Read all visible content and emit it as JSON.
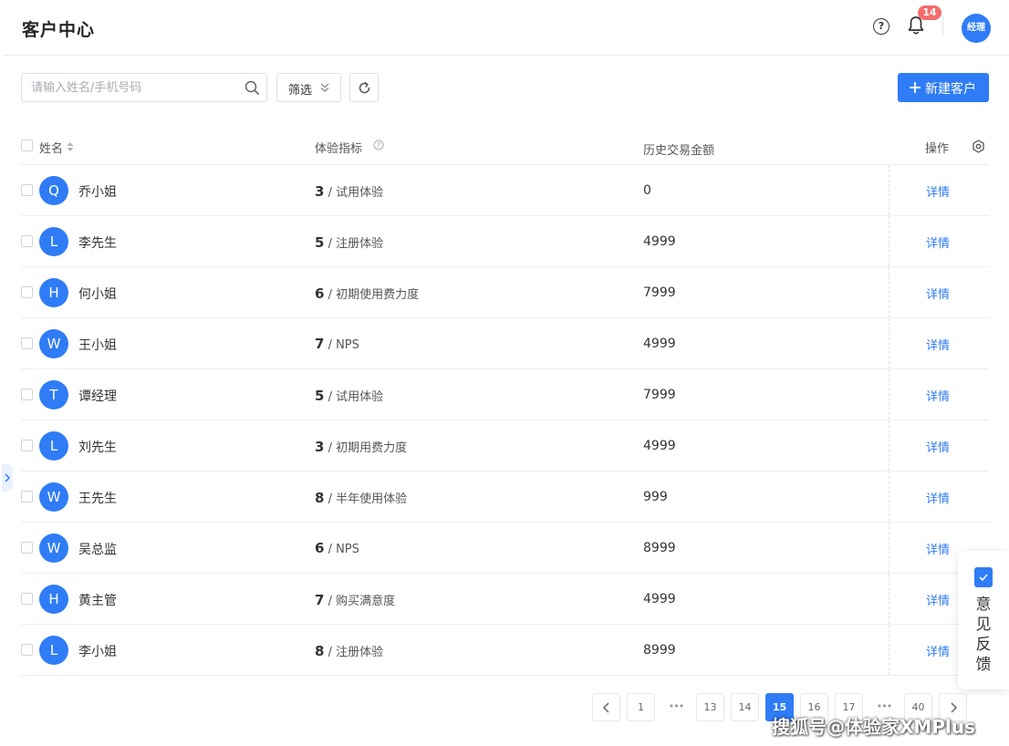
{
  "header": {
    "title": "客户中心",
    "notification_count": "14",
    "user_avatar": "经理"
  },
  "toolbar": {
    "search_placeholder": "请输入姓名/手机号码",
    "filter_label": "筛选",
    "new_label": "新建客户"
  },
  "table": {
    "columns": [
      "姓名",
      "体验指标",
      "历史交易金额",
      "操作"
    ],
    "rows": [
      {
        "initial": "Q",
        "name": "乔小姐",
        "score": "3",
        "metric": " / 试用体验",
        "amount": "0",
        "action": "详情"
      },
      {
        "initial": "L",
        "name": "李先生",
        "score": "5",
        "metric": " / 注册体验",
        "amount": "4999",
        "action": "详情"
      },
      {
        "initial": "H",
        "name": "何小姐",
        "score": "6",
        "metric": " / 初期使用费力度",
        "amount": "7999",
        "action": "详情"
      },
      {
        "initial": "W",
        "name": "王小姐",
        "score": "7",
        "metric": " / NPS",
        "amount": "4999",
        "action": "详情"
      },
      {
        "initial": "T",
        "name": "谭经理",
        "score": "5",
        "metric": " / 试用体验",
        "amount": "7999",
        "action": "详情"
      },
      {
        "initial": "L",
        "name": "刘先生",
        "score": "3",
        "metric": " / 初期用费力度",
        "amount": "4999",
        "action": "详情"
      },
      {
        "initial": "W",
        "name": "王先生",
        "score": "8",
        "metric": " / 半年使用体验",
        "amount": "999",
        "action": "详情"
      },
      {
        "initial": "W",
        "name": "吴总监",
        "score": "6",
        "metric": " / NPS",
        "amount": "8999",
        "action": "详情"
      },
      {
        "initial": "H",
        "name": "黄主管",
        "score": "7",
        "metric": " / 购买满意度",
        "amount": "4999",
        "action": "详情"
      },
      {
        "initial": "L",
        "name": "李小姐",
        "score": "8",
        "metric": " / 注册体验",
        "amount": "8999",
        "action": "详情"
      }
    ]
  },
  "pagination": {
    "pages": [
      "1",
      "13",
      "14",
      "15",
      "16",
      "17",
      "40"
    ],
    "ellipsis": "•••",
    "current": "15"
  },
  "feedback": {
    "label": "意见反馈"
  },
  "watermark": "搜狐号@体验家XMPlus",
  "colors": {
    "accent": "#2f7cf6",
    "badge": "#f56c6c",
    "border": "#ebeef5"
  },
  "icons": [
    "help-icon",
    "bell-icon",
    "search-icon",
    "filter-chevron-icon",
    "refresh-icon",
    "plus-icon",
    "sort-icon",
    "help-circle-icon",
    "settings-icon",
    "chevron-left-icon",
    "chevron-right-icon",
    "check-icon"
  ]
}
